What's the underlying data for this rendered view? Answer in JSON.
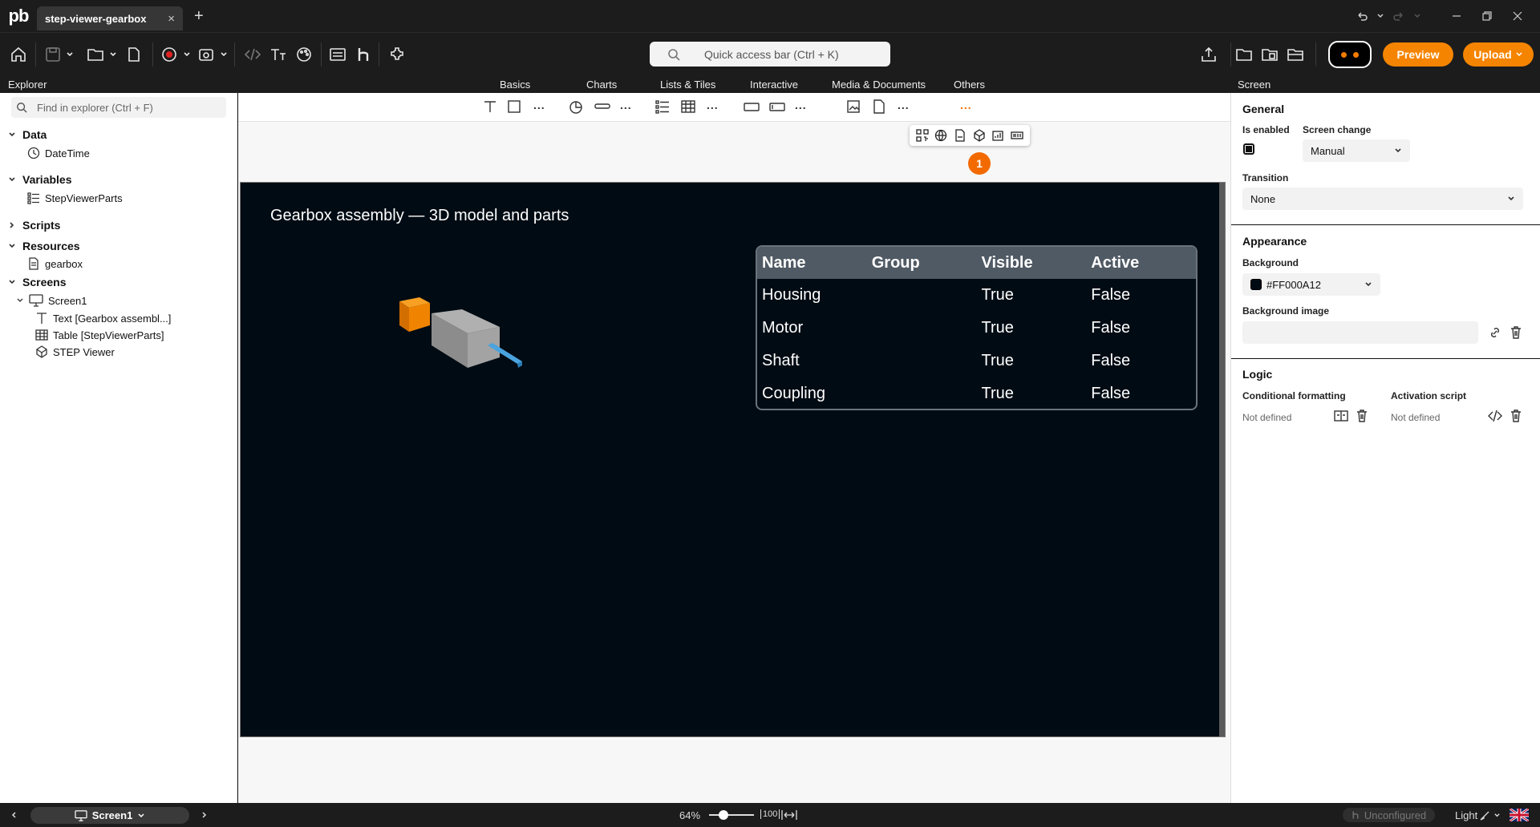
{
  "app": {
    "logo": "pb",
    "tab_title": "step-viewer-gearbox",
    "tab_close": "×",
    "new_tab": "+"
  },
  "toolbar": {
    "quick_access_placeholder": "Quick access bar (Ctrl + K)",
    "preview_label": "Preview",
    "upload_label": "Upload"
  },
  "palette": {
    "categories": [
      "Basics",
      "Charts",
      "Lists & Tiles",
      "Interactive",
      "Media & Documents",
      "Others"
    ],
    "more": "...",
    "submenu_badge": "1"
  },
  "explorer": {
    "title": "Explorer",
    "search_placeholder": "Find in explorer (Ctrl + F)",
    "sections": {
      "data": {
        "label": "Data",
        "items": [
          "DateTime"
        ]
      },
      "variables": {
        "label": "Variables",
        "items": [
          "StepViewerParts"
        ]
      },
      "scripts": {
        "label": "Scripts"
      },
      "resources": {
        "label": "Resources",
        "items": [
          "gearbox"
        ]
      },
      "screens": {
        "label": "Screens",
        "screen": "Screen1",
        "children": [
          "Text [Gearbox assembl...]",
          "Table [StepViewerParts]",
          "STEP Viewer"
        ]
      }
    }
  },
  "canvas": {
    "screen_title": "Gearbox assembly — 3D model and parts",
    "table": {
      "headers": [
        "Name",
        "Group",
        "Visible",
        "Active"
      ],
      "rows": [
        [
          "Housing",
          "",
          "True",
          "False"
        ],
        [
          "Motor",
          "",
          "True",
          "False"
        ],
        [
          "Shaft",
          "",
          "True",
          "False"
        ],
        [
          "Coupling",
          "",
          "True",
          "False"
        ]
      ]
    }
  },
  "properties": {
    "panel_title": "Screen",
    "general": {
      "heading": "General",
      "is_enabled_label": "Is enabled",
      "is_enabled": true,
      "screen_change_label": "Screen change",
      "screen_change_value": "Manual",
      "transition_label": "Transition",
      "transition_value": "None"
    },
    "appearance": {
      "heading": "Appearance",
      "background_label": "Background",
      "background_value": "#FF000A12",
      "background_swatch": "#000a12",
      "background_image_label": "Background image"
    },
    "logic": {
      "heading": "Logic",
      "cond_label": "Conditional formatting",
      "cond_value": "Not defined",
      "activation_label": "Activation script",
      "activation_value": "Not defined"
    }
  },
  "statusbar": {
    "screen": "Screen1",
    "zoom": "64%",
    "zoom_level": 0.64,
    "fit_label": "100",
    "connection": "Unconfigured",
    "theme": "Light"
  },
  "colors": {
    "accent": "#f58400",
    "badge": "#f26a00",
    "screen_bg": "#010b13",
    "table_header": "#505a64"
  }
}
